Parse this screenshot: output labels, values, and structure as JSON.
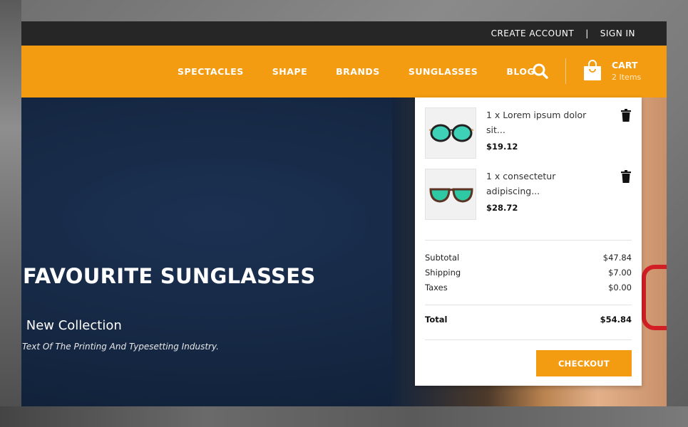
{
  "topbar": {
    "create_account": "CREATE ACCOUNT",
    "separator": "|",
    "sign_in": "SIGN IN"
  },
  "nav": {
    "items": [
      {
        "label": "SPECTACLES"
      },
      {
        "label": "SHAPE"
      },
      {
        "label": "BRANDS"
      },
      {
        "label": "SUNGLASSES"
      },
      {
        "label": "BLOG"
      }
    ],
    "search_icon": "search-icon",
    "cart": {
      "title": "CART",
      "count": "2 Items",
      "icon": "shopping-bag-icon"
    }
  },
  "hero": {
    "title": "FAVOURITE SUNGLASSES",
    "subtitle": "l New Collection",
    "text": "Text Of The Printing And Typesetting Industry."
  },
  "cart_dropdown": {
    "items": [
      {
        "name": "1 x Lorem ipsum dolor sit...",
        "price": "$19.12",
        "lens_color": "#3fd1b8"
      },
      {
        "name": "1 x consectetur adipiscing...",
        "price": "$28.72",
        "lens_color": "#2ec9a4"
      }
    ],
    "totals": [
      {
        "label": "Subtotal",
        "value": "$47.84"
      },
      {
        "label": "Shipping",
        "value": "$7.00"
      },
      {
        "label": "Taxes",
        "value": "$0.00"
      }
    ],
    "total_label": "Total",
    "total_value": "$54.84",
    "checkout_label": "CHECKOUT"
  },
  "colors": {
    "accent": "#f39c11",
    "topbar": "#262626",
    "hero": "#142641"
  }
}
